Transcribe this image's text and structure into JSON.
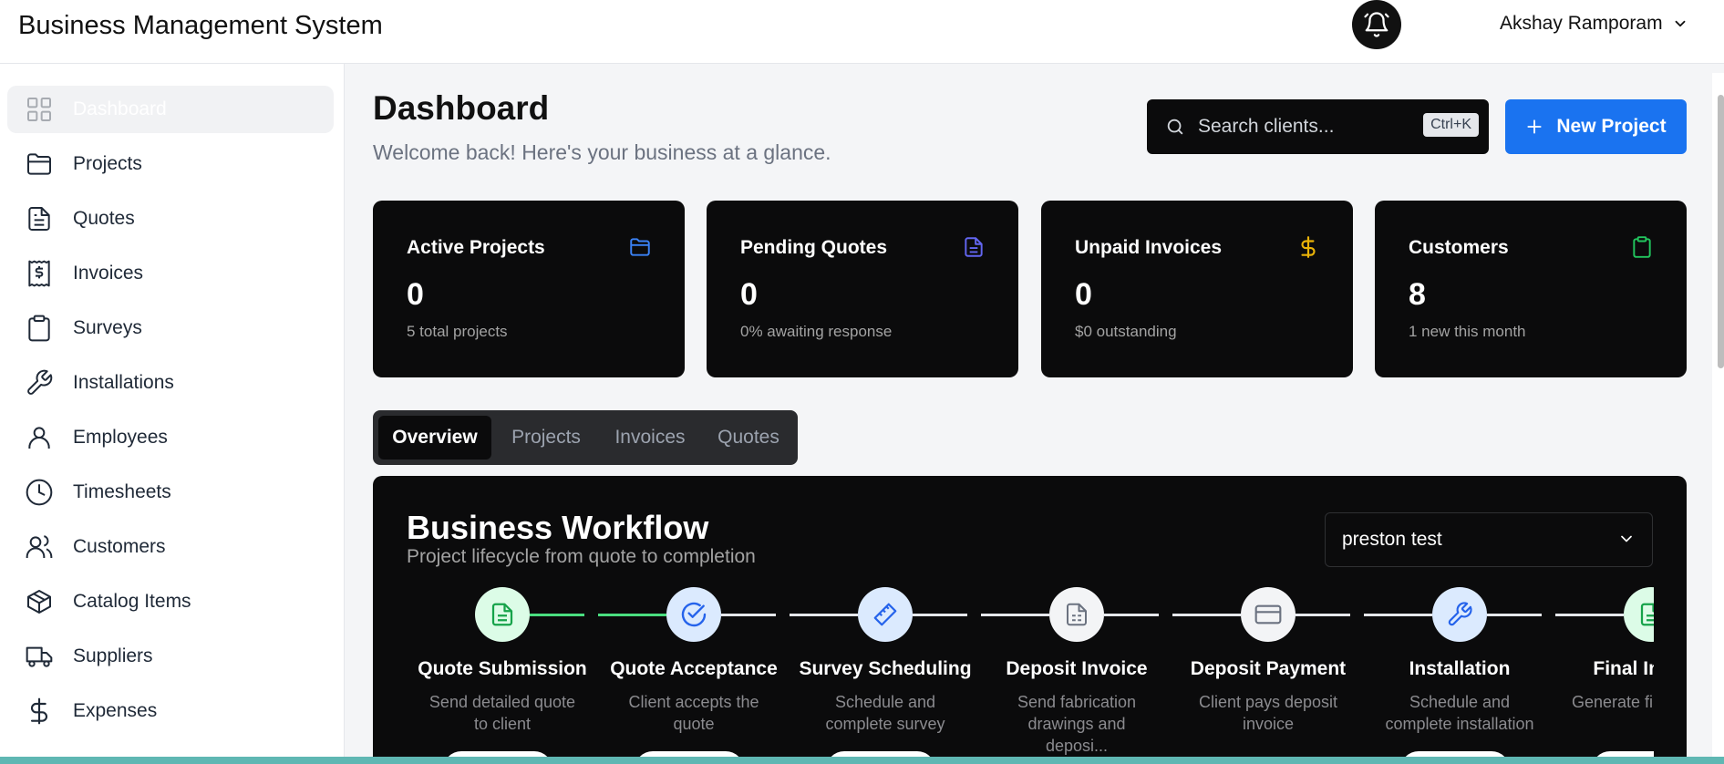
{
  "header": {
    "app_title": "Business Management System",
    "bell_icon": "bell-icon",
    "user_name": "Akshay Ramporam"
  },
  "sidebar": {
    "items": [
      {
        "label": "Dashboard",
        "icon": "grid-icon",
        "active": true
      },
      {
        "label": "Projects",
        "icon": "folder-icon"
      },
      {
        "label": "Quotes",
        "icon": "document-icon"
      },
      {
        "label": "Invoices",
        "icon": "receipt-icon"
      },
      {
        "label": "Surveys",
        "icon": "clipboard-icon"
      },
      {
        "label": "Installations",
        "icon": "wrench-icon"
      },
      {
        "label": "Employees",
        "icon": "user-icon"
      },
      {
        "label": "Timesheets",
        "icon": "clock-icon"
      },
      {
        "label": "Customers",
        "icon": "users-icon"
      },
      {
        "label": "Catalog Items",
        "icon": "box-icon"
      },
      {
        "label": "Suppliers",
        "icon": "truck-icon"
      },
      {
        "label": "Expenses",
        "icon": "dollar-icon"
      }
    ]
  },
  "main": {
    "title": "Dashboard",
    "subtitle": "Welcome back! Here's your business at a glance.",
    "search": {
      "placeholder": "Search clients...",
      "shortcut": "Ctrl+K"
    },
    "new_project_label": "New Project",
    "stats": [
      {
        "title": "Active Projects",
        "value": "0",
        "note": "5 total projects",
        "icon": "folder-icon",
        "icon_color": "#3b82f6"
      },
      {
        "title": "Pending Quotes",
        "value": "0",
        "note": "0% awaiting response",
        "icon": "document-icon",
        "icon_color": "#6366f1"
      },
      {
        "title": "Unpaid Invoices",
        "value": "0",
        "note": "$0 outstanding",
        "icon": "dollar-icon",
        "icon_color": "#eab308"
      },
      {
        "title": "Customers",
        "value": "8",
        "note": "1 new this month",
        "icon": "clipboard-icon",
        "icon_color": "#22c55e"
      }
    ],
    "tabs": [
      "Overview",
      "Projects",
      "Invoices",
      "Quotes"
    ],
    "active_tab": "Overview",
    "workflow": {
      "title": "Business Workflow",
      "subtitle": "Project lifecycle from quote to completion",
      "selected_project": "preston test",
      "steps": [
        {
          "title": "Quote Submission",
          "desc": "Send detailed quote to client",
          "icon": "document-icon",
          "state": "done"
        },
        {
          "title": "Quote Acceptance",
          "desc": "Client accepts the quote",
          "icon": "check-circle-icon",
          "state": "current"
        },
        {
          "title": "Survey Scheduling",
          "desc": "Schedule and complete survey",
          "icon": "ruler-icon",
          "state": "upcoming-blue"
        },
        {
          "title": "Deposit Invoice",
          "desc": "Send fabrication drawings and deposi...",
          "icon": "invoice-icon",
          "state": "upcoming"
        },
        {
          "title": "Deposit Payment",
          "desc": "Client pays deposit invoice",
          "icon": "credit-card-icon",
          "state": "upcoming"
        },
        {
          "title": "Installation",
          "desc": "Schedule and complete installation",
          "icon": "wrench-icon",
          "state": "upcoming-blue"
        },
        {
          "title": "Final Invoice",
          "desc": "Generate final invoice",
          "icon": "document-icon",
          "state": "done"
        }
      ]
    }
  },
  "colors": {
    "accent": "#1a73f0",
    "card_bg": "#0b0b0c",
    "done_green": "#22c55e",
    "step_blue": "#2563eb"
  }
}
